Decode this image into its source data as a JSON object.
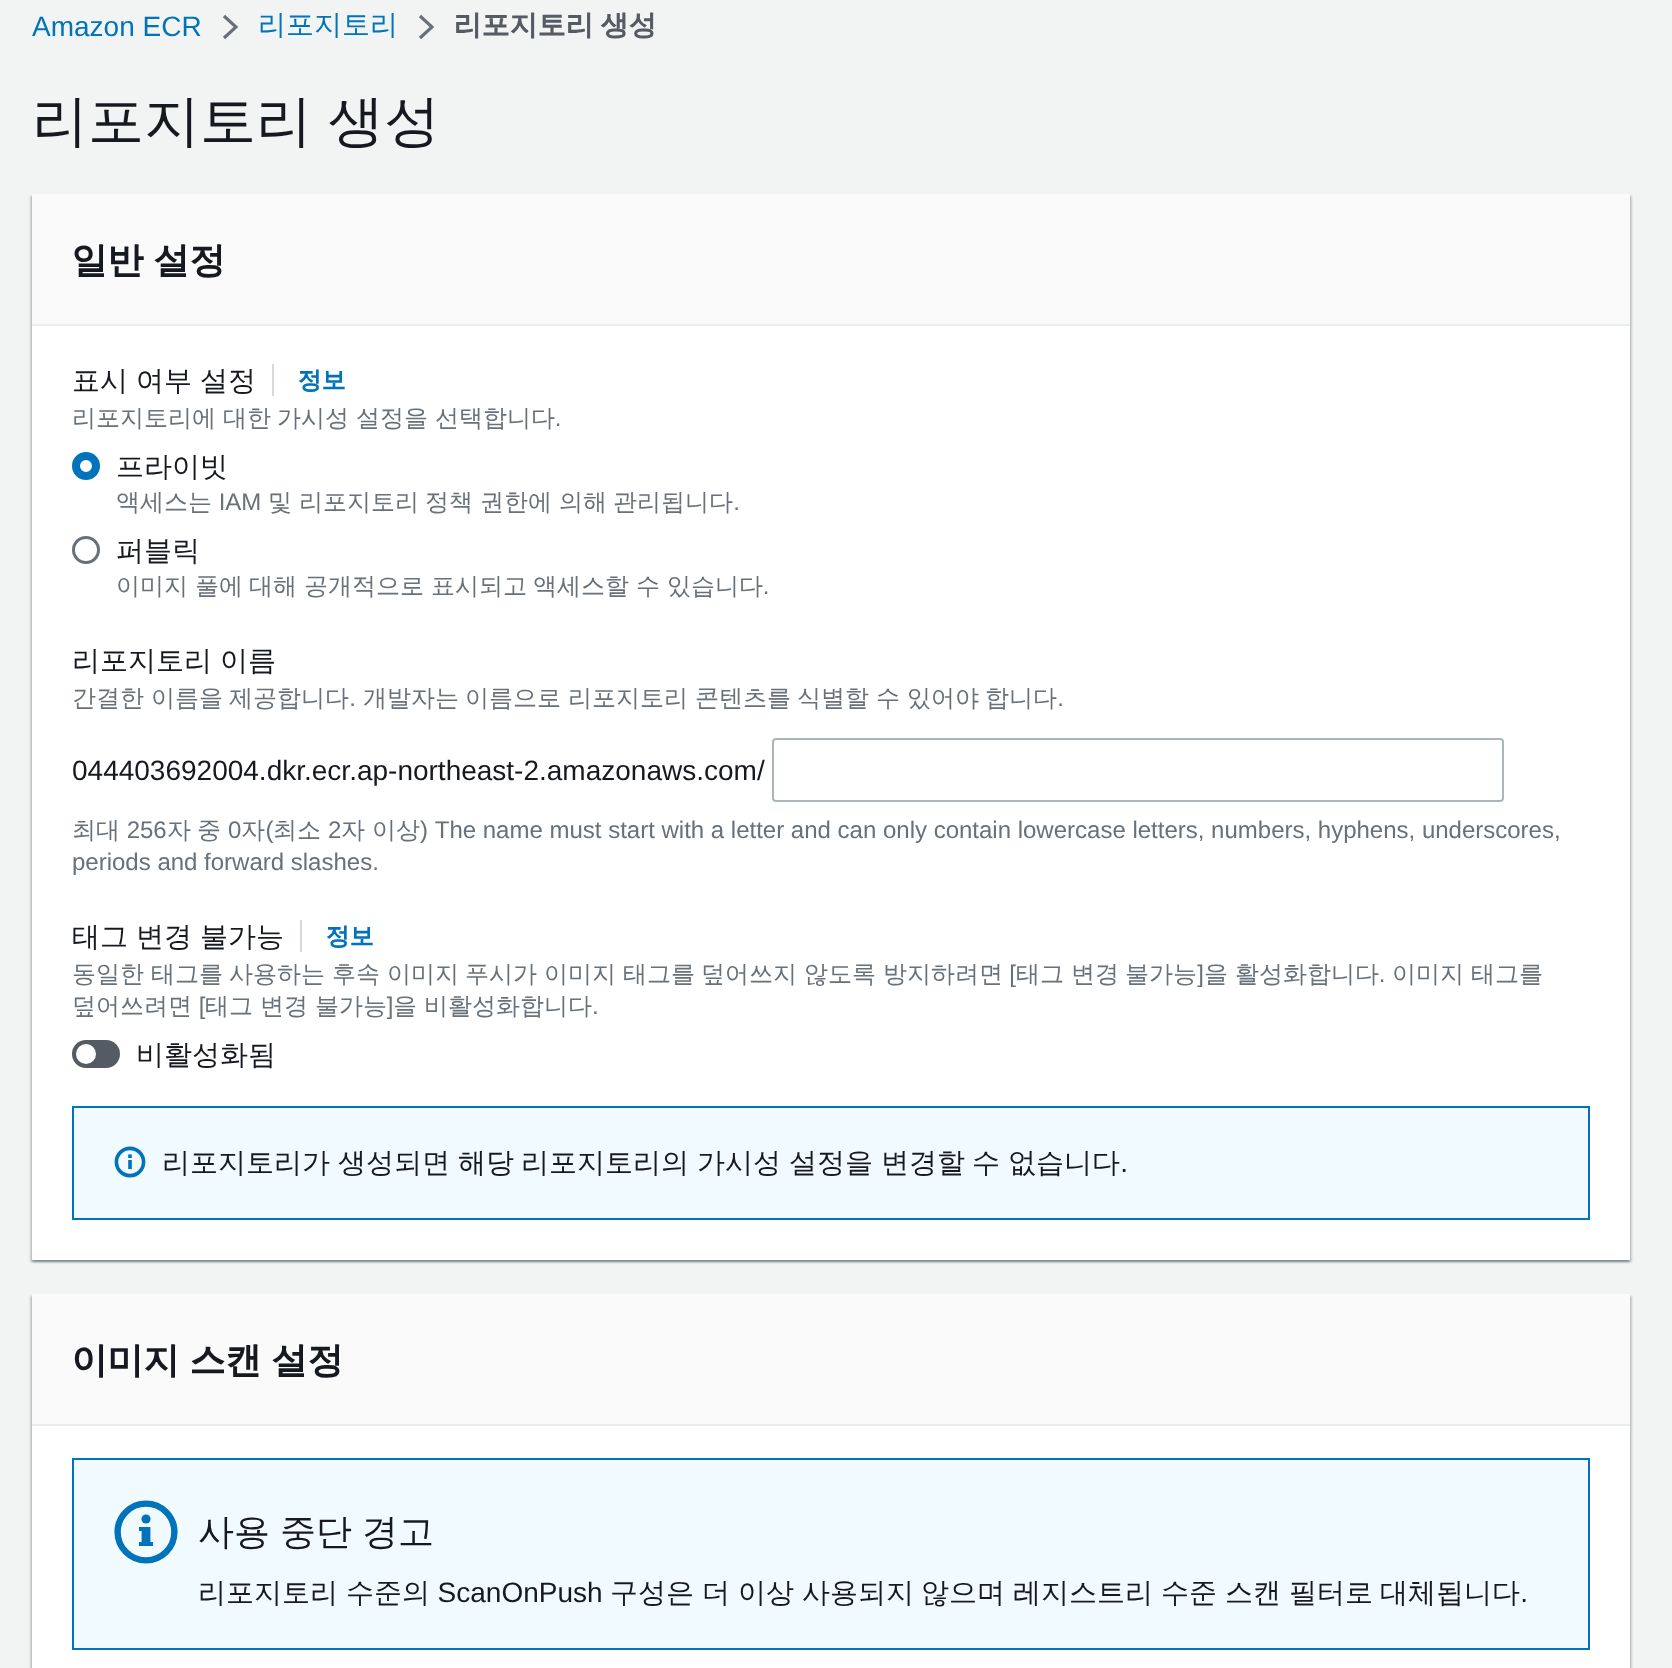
{
  "breadcrumb": [
    {
      "label": "Amazon ECR",
      "kind": "link"
    },
    {
      "label": "리포지토리",
      "kind": "link"
    },
    {
      "label": "리포지토리 생성",
      "kind": "current"
    }
  ],
  "page_title": "리포지토리 생성",
  "general_settings": {
    "title": "일반 설정",
    "visibility": {
      "label": "표시 여부 설정",
      "info": "정보",
      "description": "리포지토리에 대한 가시성 설정을 선택합니다.",
      "options": [
        {
          "label": "프라이빗",
          "description": "액세스는 IAM 및 리포지토리 정책 권한에 의해 관리됩니다.",
          "selected": true
        },
        {
          "label": "퍼블릭",
          "description": "이미지 풀에 대해 공개적으로 표시되고 액세스할 수 있습니다.",
          "selected": false
        }
      ]
    },
    "repository_name": {
      "label": "리포지토리 이름",
      "description": "간결한 이름을 제공합니다. 개발자는 이름으로 리포지토리 콘텐츠를 식별할 수 있어야 합니다.",
      "prefix": "044403692004.dkr.ecr.ap-northeast-2.amazonaws.com/",
      "constraint": "최대 256자 중 0자(최소 2자 이상) The name must start with a letter and can only contain lowercase letters, numbers, hyphens, underscores, periods and forward slashes."
    },
    "tag_immutability": {
      "label": "태그 변경 불가능",
      "info": "정보",
      "description": "동일한 태그를 사용하는 후속 이미지 푸시가 이미지 태그를 덮어쓰지 않도록 방지하려면 [태그 변경 불가능]을 활성화합니다. 이미지 태그를 덮어쓰려면 [태그 변경 불가능]을 비활성화합니다.",
      "toggle": {
        "label": "비활성화됨",
        "on": false
      }
    },
    "alert": {
      "text": "리포지토리가 생성되면 해당 리포지토리의 가시성 설정을 변경할 수 없습니다."
    }
  },
  "image_scan_settings": {
    "title": "이미지 스캔 설정",
    "alert": {
      "title": "사용 중단 경고",
      "text": "리포지토리 수준의 ScanOnPush 구성은 더 이상 사용되지 않으며 레지스트리 수준 스캔 필터로 대체됩니다."
    }
  }
}
